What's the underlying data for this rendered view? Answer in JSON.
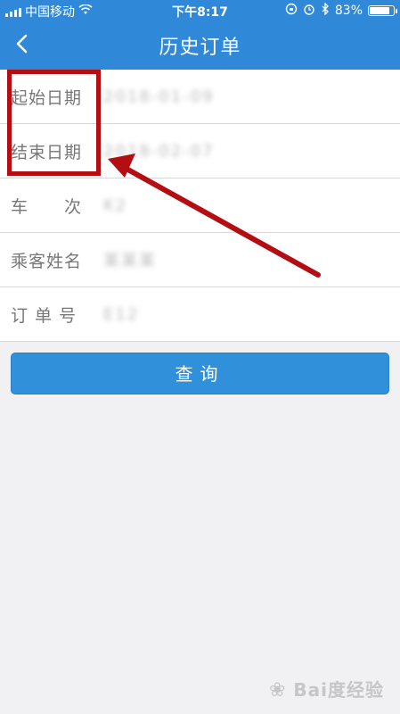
{
  "status_bar": {
    "carrier": "中国移动",
    "time": "下午8:17",
    "battery": "83%"
  },
  "nav": {
    "title": "历史订单"
  },
  "form": {
    "rows": [
      {
        "label": "起始日期",
        "value": "2018-01-09"
      },
      {
        "label": "结束日期",
        "value": "2018-02-07"
      },
      {
        "label": "车　　次",
        "value": "K2"
      },
      {
        "label": "乘客姓名",
        "value": "某某某"
      },
      {
        "label": "订 单 号",
        "value": "E12"
      }
    ]
  },
  "actions": {
    "query_label": "查询"
  },
  "watermark": {
    "text": "Bai度经验"
  },
  "colors": {
    "header": "#2f89d8",
    "button": "#3190da",
    "annotation": "#b40d12"
  }
}
